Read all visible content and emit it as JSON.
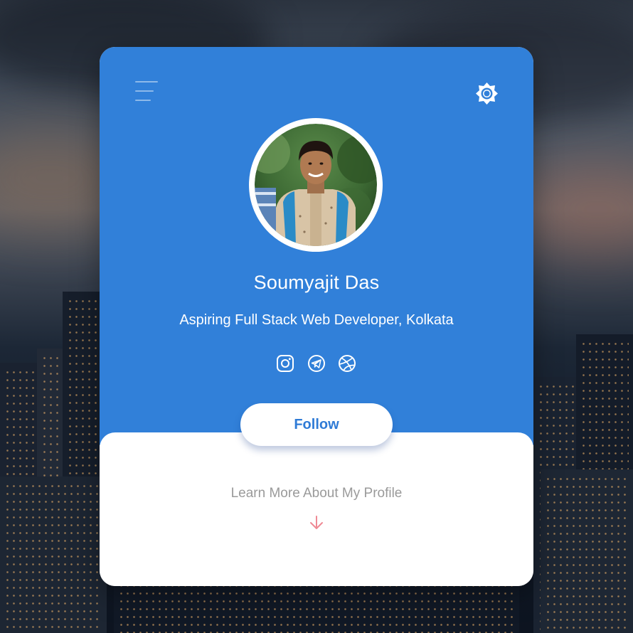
{
  "profile": {
    "name": "Soumyajit Das",
    "bio": "Aspiring Full Stack Web Developer, Kolkata",
    "avatar_alt": "profile photo"
  },
  "header": {
    "menu_icon": "hamburger-menu-icon",
    "theme_icon": "brightness-icon"
  },
  "socials": [
    {
      "name": "instagram",
      "icon": "instagram-icon"
    },
    {
      "name": "telegram",
      "icon": "telegram-icon"
    },
    {
      "name": "dribbble",
      "icon": "dribbble-icon"
    }
  ],
  "actions": {
    "follow_label": "Follow",
    "learn_more_label": "Learn More About My Profile",
    "arrow_icon": "arrow-down-icon"
  },
  "colors": {
    "card_accent": "#3180d9",
    "follow_text": "#2f7bd6",
    "learn_more_text": "#9a9a9a",
    "arrow": "#ef8a95"
  }
}
